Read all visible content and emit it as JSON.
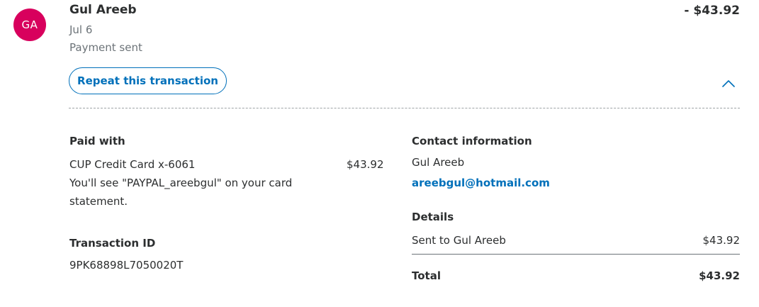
{
  "transaction": {
    "avatar_initials": "GA",
    "name": "Gul Areeb",
    "date": "Jul 6",
    "status": "Payment sent",
    "amount": "- $43.92",
    "repeat_label": "Repeat this transaction"
  },
  "paid_with": {
    "label": "Paid with",
    "card": "CUP Credit Card x-6061",
    "amount": "$43.92",
    "statement_note": "You'll see \"PAYPAL_areebgul\" on your card statement."
  },
  "transaction_id": {
    "label": "Transaction ID",
    "value": "9PK68898L7050020T"
  },
  "contact": {
    "label": "Contact information",
    "name": "Gul Areeb",
    "email": "areebgul@hotmail.com"
  },
  "details": {
    "label": "Details",
    "sent_to_label": "Sent to Gul Areeb",
    "sent_to_amount": "$43.92",
    "total_label": "Total",
    "total_amount": "$43.92"
  },
  "icons": {
    "collapse": "chevron-up-icon"
  },
  "colors": {
    "avatar": "#d8005d",
    "link": "#0070ba",
    "text": "#2c2e2f",
    "muted": "#6c7378"
  }
}
